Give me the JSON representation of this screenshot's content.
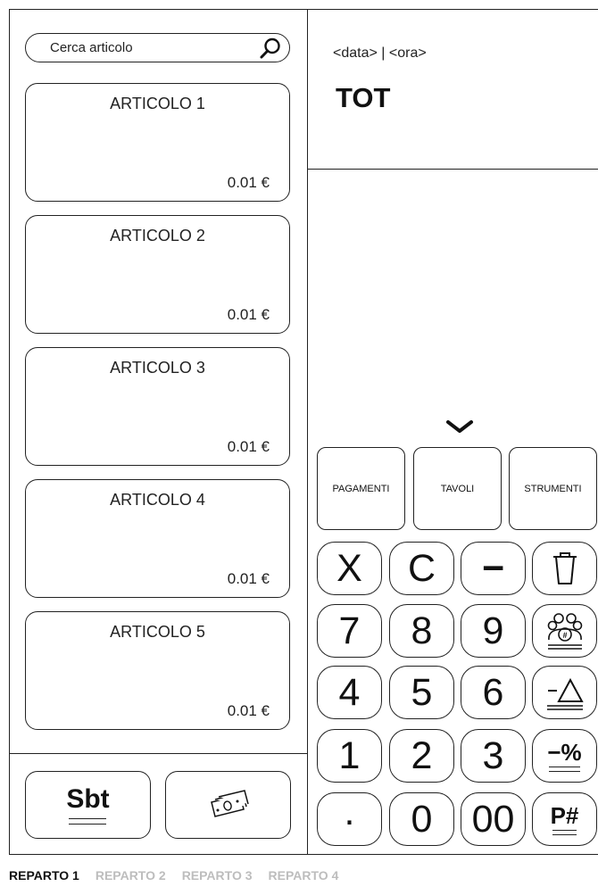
{
  "search": {
    "placeholder": "Cerca articolo",
    "icon": "search-icon"
  },
  "articles": [
    {
      "name": "ARTICOLO 1",
      "price": "0.01 €"
    },
    {
      "name": "ARTICOLO 2",
      "price": "0.01 €"
    },
    {
      "name": "ARTICOLO 3",
      "price": "0.01 €"
    },
    {
      "name": "ARTICOLO 4",
      "price": "0.01 €"
    },
    {
      "name": "ARTICOLO 5",
      "price": "0.01 €"
    }
  ],
  "actions": {
    "subtotal": "Sbt",
    "cash_icon": "cash-icon"
  },
  "header": {
    "datetime": "<data> | <ora>",
    "total_label": "TOT"
  },
  "tabs": [
    "PAGAMENTI",
    "TAVOLI",
    "STRUMENTI"
  ],
  "keypad": {
    "clear_all": "X",
    "clear": "C",
    "minus": "−",
    "digits": [
      "7",
      "8",
      "9",
      "4",
      "5",
      "6",
      "1",
      "2",
      "3",
      ".",
      "0",
      "00"
    ],
    "function_labels": {
      "discount_pct": "−%",
      "plu": "P#"
    }
  },
  "departments": [
    {
      "label": "REPARTO 1",
      "active": true
    },
    {
      "label": "REPARTO 2",
      "active": false
    },
    {
      "label": "REPARTO 3",
      "active": false
    },
    {
      "label": "REPARTO 4",
      "active": false
    }
  ]
}
